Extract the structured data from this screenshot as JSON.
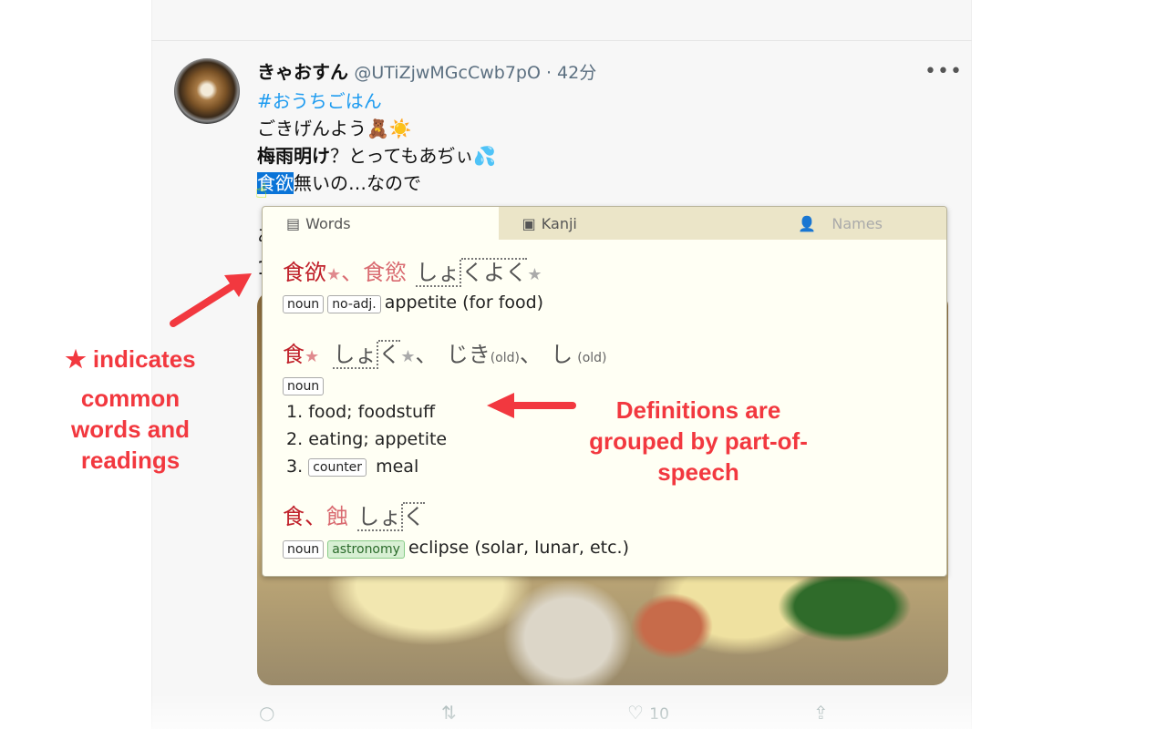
{
  "tweet": {
    "name": "きゃおすん",
    "handle": "@UTiZjwMGcCwb7pO · 42分",
    "more": "•••",
    "hashtag": "#おうちごはん",
    "line1": "ごきげんよう🧸☀️",
    "line2_bold": "梅雨明け",
    "line2": "？とってもあぢぃ💦",
    "line3_sel": "食欲",
    "line3": "無いの…なので",
    "line4": "あ",
    "line5": "1",
    "like_count": "10"
  },
  "popup": {
    "tabs": [
      {
        "label": "Words",
        "icon": "book-icon"
      },
      {
        "label": "Kanji",
        "icon": "kanji-icon"
      },
      {
        "label": "Names",
        "icon": "person-icon"
      }
    ],
    "entries": [
      {
        "kanji": "食欲",
        "sep": "、",
        "kanji2": "食慾",
        "reading_a": "しょ",
        "reading_b": "くよく",
        "pos": [
          "noun",
          "no-adj."
        ],
        "gloss": "appetite (for food)"
      },
      {
        "kanji": "食",
        "reading_a": "しょ",
        "reading_b": "く",
        "sep": "、",
        "reading2": "じき",
        "old": "(old)",
        "sep2": "、",
        "reading3": "し",
        "old3": "(old)",
        "pos": [
          "noun"
        ],
        "senses": [
          {
            "n": "1.",
            "text": "food; foodstuff"
          },
          {
            "n": "2.",
            "text": "eating; appetite"
          },
          {
            "n": "3.",
            "tag": "counter",
            "text": "meal"
          }
        ]
      },
      {
        "kanji": "食",
        "sep": "、",
        "kanji2": "蝕",
        "reading_a": "しょ",
        "reading_b": "く",
        "pos": [
          "noun",
          "astronomy"
        ],
        "gloss": "eclipse (solar, lunar, etc.)"
      }
    ]
  },
  "annotations": {
    "left": [
      "★ indicates",
      "common",
      "words and",
      "readings"
    ],
    "right": [
      "Definitions are",
      "grouped by part-of-",
      "speech"
    ]
  },
  "colors": {
    "accent": "#f2383f",
    "hashtag": "#1d9bf0",
    "selection": "#0a74d8"
  }
}
